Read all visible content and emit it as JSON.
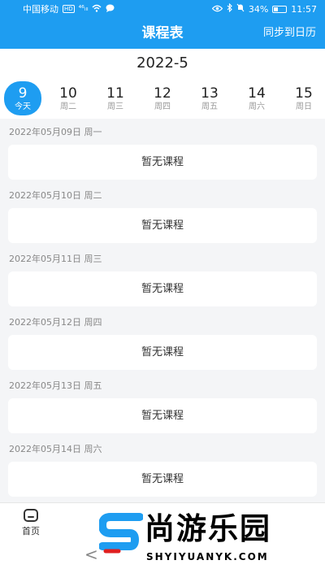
{
  "status_bar": {
    "carrier": "中国移动",
    "hd": "HD",
    "signal": "⁴⁶ᵢₗₗ",
    "battery": "34%",
    "battery_level": 0.34,
    "time": "11:57"
  },
  "header": {
    "title": "课程表",
    "sync_label": "同步到日历"
  },
  "month": "2022-5",
  "week": [
    {
      "num": "9",
      "label": "今天",
      "today": true
    },
    {
      "num": "10",
      "label": "周二"
    },
    {
      "num": "11",
      "label": "周三"
    },
    {
      "num": "12",
      "label": "周四"
    },
    {
      "num": "13",
      "label": "周五"
    },
    {
      "num": "14",
      "label": "周六"
    },
    {
      "num": "15",
      "label": "周日"
    }
  ],
  "schedule": [
    {
      "date": "2022年05月09日 周一",
      "content": "暂无课程"
    },
    {
      "date": "2022年05月10日 周二",
      "content": "暂无课程"
    },
    {
      "date": "2022年05月11日 周三",
      "content": "暂无课程"
    },
    {
      "date": "2022年05月12日 周四",
      "content": "暂无课程"
    },
    {
      "date": "2022年05月13日 周五",
      "content": "暂无课程"
    },
    {
      "date": "2022年05月14日 周六",
      "content": "暂无课程"
    }
  ],
  "tabbar": {
    "home_label": "首页"
  },
  "watermark": {
    "text": "尚游乐园",
    "url": "SHYIYUANYK.COM",
    "brand_color": "#1e9df1"
  },
  "colors": {
    "accent": "#1e9df1",
    "watermark_red": "#e02020"
  }
}
